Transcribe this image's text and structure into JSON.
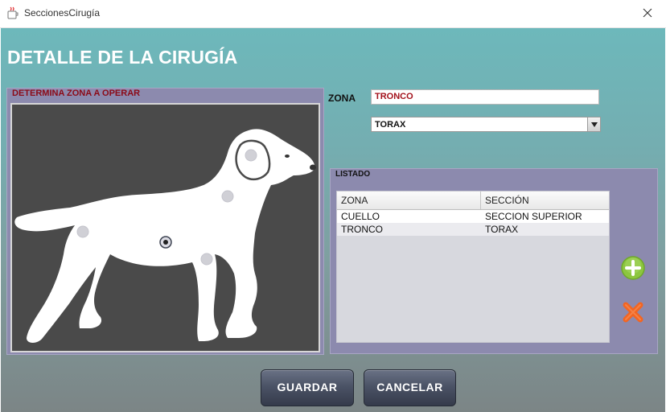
{
  "window": {
    "title": "SeccionesCirugía"
  },
  "header": {
    "title": "DETALLE DE LA CIRUGÍA"
  },
  "zone_panel": {
    "title": "DETERMINA ZONA A OPERAR"
  },
  "form": {
    "zona_label": "ZONA",
    "zona_value": "TRONCO",
    "seccion_value": "TORAX"
  },
  "listado": {
    "title": "LISTADO",
    "columns": [
      "ZONA",
      "SECCIÓN"
    ],
    "rows": [
      {
        "zona": "CUELLO",
        "seccion": "SECCION SUPERIOR"
      },
      {
        "zona": "TRONCO",
        "seccion": "TORAX"
      }
    ]
  },
  "buttons": {
    "save": "GUARDAR",
    "cancel": "CANCELAR"
  },
  "colors": {
    "accent_red": "#8b0a17",
    "panel": "#8c8aae",
    "add_green": "#8cc63f",
    "delete_orange": "#f26522"
  }
}
